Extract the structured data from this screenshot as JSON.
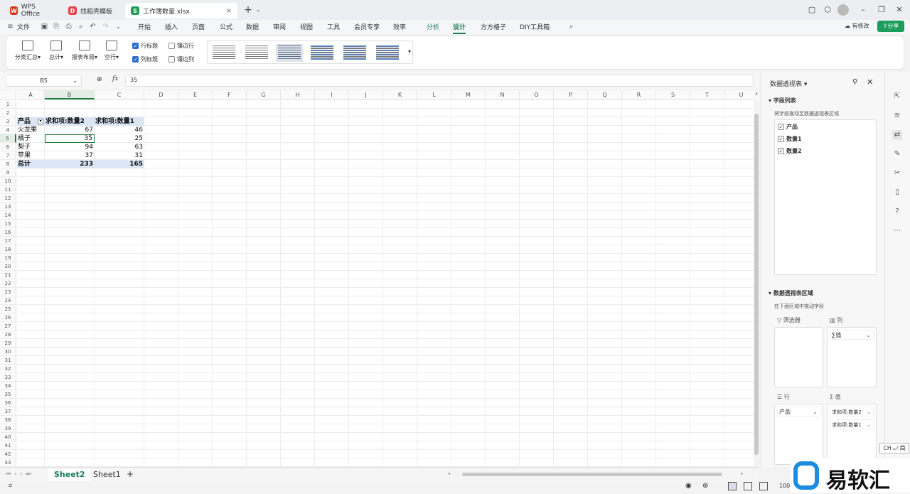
{
  "titlebar": {
    "tabs": [
      {
        "label": "WPS Office",
        "icon": "wps-logo-icon",
        "color": "#d4311c"
      },
      {
        "label": "找稻壳模板",
        "icon": "docer-icon",
        "color": "#e04545"
      },
      {
        "label": "工作簿数量.xlsx",
        "icon": "spreadsheet-icon",
        "color": "#1c9d5a"
      }
    ]
  },
  "menubar": {
    "file": "文件",
    "items": [
      "开始",
      "插入",
      "页面",
      "公式",
      "数据",
      "审阅",
      "视图",
      "工具",
      "会员专享",
      "效率",
      "分析",
      "设计",
      "方方格子",
      "DIY工具箱"
    ],
    "active": "设计",
    "edit_status": "有修改",
    "share": "分享"
  },
  "ribbon": {
    "buttons": [
      "分类汇总",
      "总计",
      "报表布局",
      "空行"
    ],
    "checks": [
      {
        "label": "行标题",
        "checked": true
      },
      {
        "label": "镶边行",
        "checked": false
      },
      {
        "label": "列标题",
        "checked": true
      },
      {
        "label": "镶边列",
        "checked": false
      }
    ]
  },
  "formula": {
    "cell": "B5",
    "fx": "fx",
    "value": "35"
  },
  "columns": [
    "A",
    "B",
    "C",
    "D",
    "E",
    "F",
    "G",
    "H",
    "I",
    "J",
    "K",
    "L",
    "M",
    "N",
    "O",
    "P",
    "Q",
    "R",
    "S",
    "T",
    "U"
  ],
  "rows": [
    "1",
    "2",
    "3",
    "4",
    "5",
    "6",
    "7",
    "8",
    "9",
    "10",
    "11",
    "12",
    "13",
    "14",
    "15",
    "16",
    "17",
    "18",
    "19",
    "20",
    "21",
    "22",
    "23",
    "24",
    "25",
    "26",
    "27",
    "28",
    "29",
    "30",
    "31",
    "32",
    "33",
    "34",
    "35",
    "36",
    "37",
    "38",
    "39",
    "40",
    "41",
    "42",
    "43"
  ],
  "pivot": {
    "header": [
      "产品",
      "求和项:数量2",
      "求和项:数量1"
    ],
    "rows": [
      [
        "火龙果",
        "67",
        "46"
      ],
      [
        "橘子",
        "35",
        "25"
      ],
      [
        "梨子",
        "94",
        "63"
      ],
      [
        "苹果",
        "37",
        "31"
      ]
    ],
    "total": [
      "总计",
      "233",
      "165"
    ]
  },
  "sheets": [
    "Sheet2",
    "Sheet1"
  ],
  "active_sheet": "Sheet2",
  "status": {
    "zoom": "100"
  },
  "panel": {
    "title": "数据透视表",
    "fields_title": "字段列表",
    "fields_hint": "将字段拖动至数据透视表区域",
    "fields": [
      "产品",
      "数量1",
      "数量2"
    ],
    "areas_title": "数据透视表区域",
    "areas_hint": "在下面区域中拖动字段",
    "filter": "筛选器",
    "col": "列",
    "row": "行",
    "val": "值",
    "col_item": "∑值",
    "row_item": "产品",
    "val_items": [
      "求和项:数量2",
      "求和项:数量1"
    ]
  },
  "ime": "CH ⤾ 简",
  "watermark": "易软汇"
}
